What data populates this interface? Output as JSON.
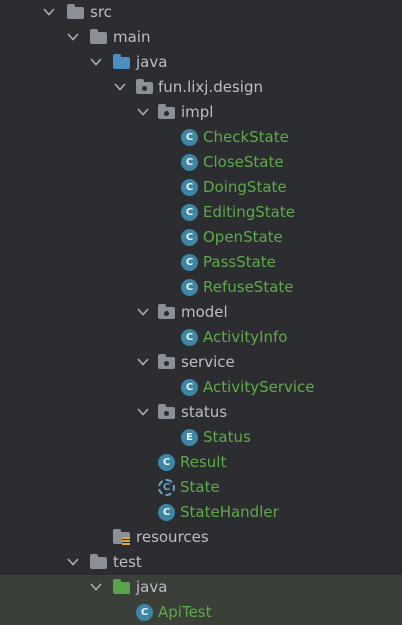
{
  "tree": {
    "nodes": [
      {
        "label": "src",
        "type": "folder",
        "expanded": true,
        "icon": "folder-icon"
      },
      {
        "label": "main",
        "type": "folder",
        "expanded": true,
        "icon": "folder-icon"
      },
      {
        "label": "java",
        "type": "source-root",
        "expanded": true,
        "icon": "source-folder-icon"
      },
      {
        "label": "fun.lixj.design",
        "type": "package",
        "expanded": true,
        "icon": "package-icon"
      },
      {
        "label": "impl",
        "type": "package",
        "expanded": true,
        "icon": "package-icon"
      },
      {
        "label": "CheckState",
        "type": "class",
        "icon": "class-icon",
        "badge": "C"
      },
      {
        "label": "CloseState",
        "type": "class",
        "icon": "class-icon",
        "badge": "C"
      },
      {
        "label": "DoingState",
        "type": "class",
        "icon": "class-icon",
        "badge": "C"
      },
      {
        "label": "EditingState",
        "type": "class",
        "icon": "class-icon",
        "badge": "C"
      },
      {
        "label": "OpenState",
        "type": "class",
        "icon": "class-icon",
        "badge": "C"
      },
      {
        "label": "PassState",
        "type": "class",
        "icon": "class-icon",
        "badge": "C"
      },
      {
        "label": "RefuseState",
        "type": "class",
        "icon": "class-icon",
        "badge": "C"
      },
      {
        "label": "model",
        "type": "package",
        "expanded": true,
        "icon": "package-icon"
      },
      {
        "label": "ActivityInfo",
        "type": "class",
        "icon": "class-icon",
        "badge": "C"
      },
      {
        "label": "service",
        "type": "package",
        "expanded": true,
        "icon": "package-icon"
      },
      {
        "label": "ActivityService",
        "type": "class",
        "icon": "class-icon",
        "badge": "C"
      },
      {
        "label": "status",
        "type": "package",
        "expanded": true,
        "icon": "package-icon"
      },
      {
        "label": "Status",
        "type": "enum",
        "icon": "enum-icon",
        "badge": "E"
      },
      {
        "label": "Result",
        "type": "class",
        "icon": "class-icon",
        "badge": "C"
      },
      {
        "label": "State",
        "type": "abstract-class",
        "icon": "abstract-class-icon",
        "badge": "C"
      },
      {
        "label": "StateHandler",
        "type": "class",
        "icon": "class-icon",
        "badge": "C"
      },
      {
        "label": "resources",
        "type": "resources-root",
        "icon": "resources-folder-icon"
      },
      {
        "label": "test",
        "type": "folder",
        "expanded": true,
        "icon": "folder-icon"
      },
      {
        "label": "java",
        "type": "test-root",
        "expanded": true,
        "icon": "test-folder-icon"
      },
      {
        "label": "ApiTest",
        "type": "test-class",
        "icon": "test-class-icon",
        "badge": "C"
      }
    ]
  },
  "colors": {
    "background": "#2b2d30",
    "text": "#bcbec4",
    "class_text": "#5fa94a",
    "test_tint": "#3a3f37",
    "class_icon": "#3e86a6",
    "source_folder": "#4a8ec2",
    "test_folder": "#5aa34d"
  }
}
